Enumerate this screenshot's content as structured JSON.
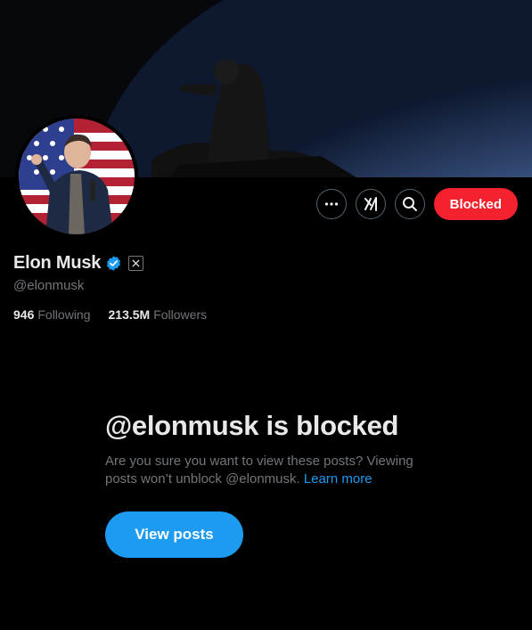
{
  "profile": {
    "name": "Elon Musk",
    "handle": "@elonmusk",
    "following_count": "946",
    "following_label": "Following",
    "followers_count": "213.5M",
    "followers_label": "Followers"
  },
  "actions": {
    "more_icon": "more-dots-icon",
    "grok_icon": "grok-icon",
    "search_icon": "search-icon",
    "blocked_label": "Blocked"
  },
  "block_notice": {
    "title": "@elonmusk is blocked",
    "message": "Are you sure you want to view these posts? Viewing posts won’t unblock @elonmusk.",
    "learn_more": "Learn more",
    "view_button": "View posts"
  },
  "colors": {
    "accent": "#1d9bf0",
    "blocked": "#f4212e",
    "muted": "#71767b",
    "background": "#000000"
  }
}
